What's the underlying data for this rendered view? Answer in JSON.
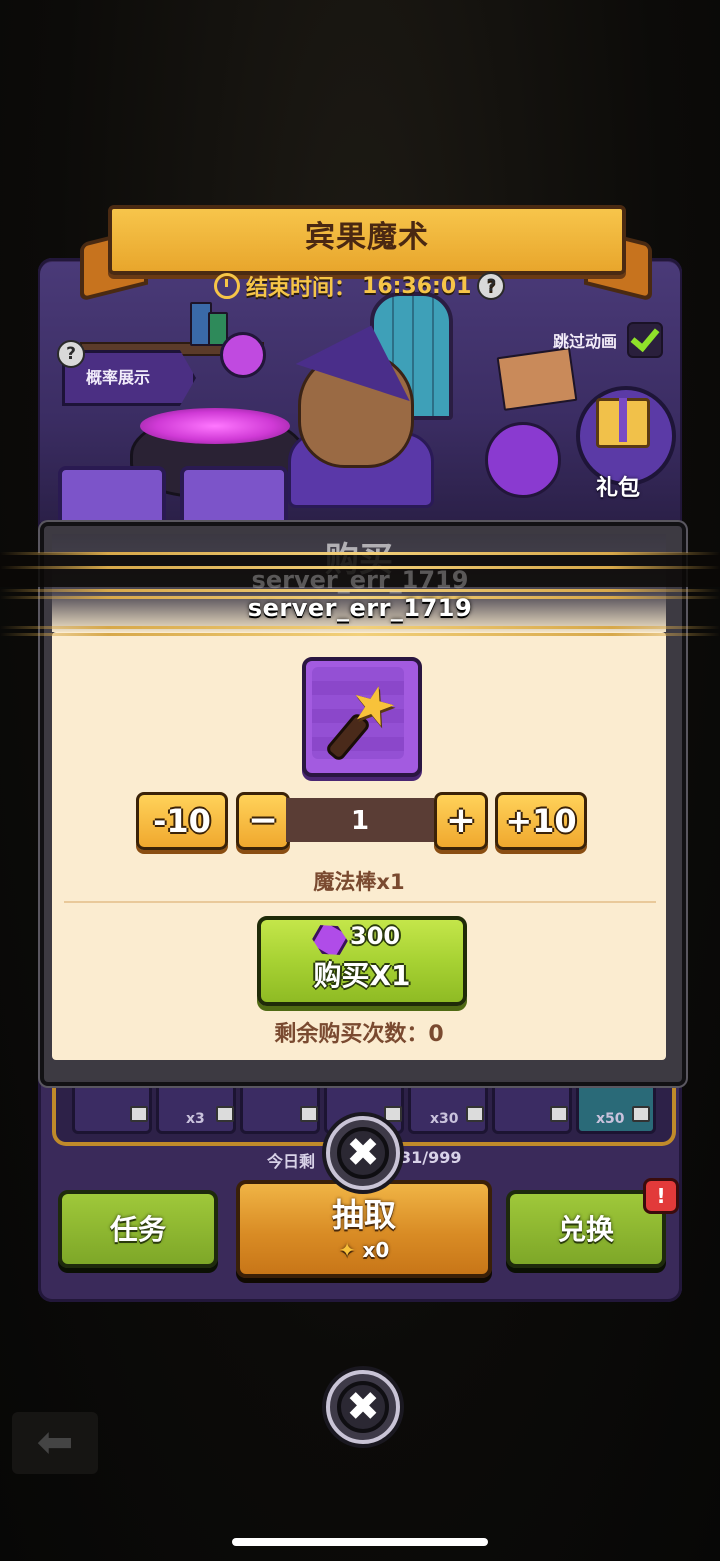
{
  "event": {
    "title": "宾果魔术",
    "timer_label": "结束时间：",
    "timer_value": "16:36:01",
    "skip_animation_label": "跳过动画",
    "probability_label": "概率展示",
    "gift_label": "礼包"
  },
  "grid": {
    "counts": [
      "x3",
      "x30",
      "x50"
    ]
  },
  "daily": {
    "label": "今日剩",
    "count": "31/999"
  },
  "bottom_buttons": {
    "tasks_label": "任务",
    "draw_label": "抽取",
    "draw_cost": "x0",
    "exchange_label": "兑换",
    "exchange_badge": "!"
  },
  "modal": {
    "title": "购买",
    "error_ghost": "server_err_1719",
    "error_text": "server_err_1719",
    "item_name": "魔法棒x1",
    "qty_minus10": "-10",
    "qty_minus": "−",
    "quantity": "1",
    "qty_plus": "+",
    "qty_plus10": "+10",
    "price": "300",
    "buy_label": "购买X1",
    "remaining_label": "剩余购买次数：0"
  },
  "colors": {
    "accent_gold": "#f6c548",
    "buy_green": "#a7d233",
    "item_purple": "#a35be0"
  },
  "icons": {
    "close": "close-icon",
    "timer": "timer-icon",
    "help": "help-icon",
    "gem": "gem-icon",
    "wand": "magic-wand-icon",
    "back": "back-arrow-icon"
  }
}
